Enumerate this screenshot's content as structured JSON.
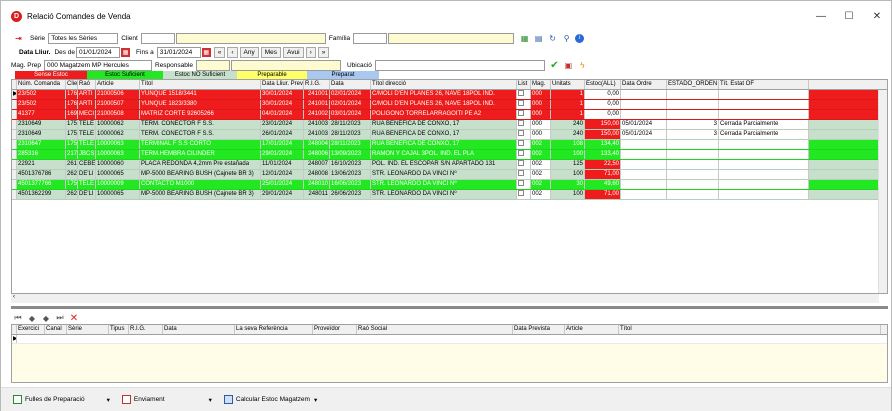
{
  "window": {
    "title": "Relació Comandes de Venda",
    "icon": "D"
  },
  "filters": {
    "serie_label": "Sèrie",
    "serie_value": "Totes les Sèries",
    "client_label": "Client",
    "familia_label": "Família",
    "data_label": "Data Lliur.",
    "des_de": "Des de",
    "des_de_value": "01/01/2024",
    "fins_a": "Fins a",
    "fins_a_value": "31/01/2024",
    "btn_any": "Any",
    "btn_mes": "Mes",
    "btn_avui": "Avui",
    "mag_label": "Mag. Prep",
    "mag_value": "000 Magatzem MP Hercules",
    "responsable_label": "Responsable",
    "ubicacio_label": "Ubicació"
  },
  "legend": [
    "Sense Estoc",
    "Estoc Suficient",
    "Estoc NO Suficient",
    "Preparable",
    "Preparat"
  ],
  "columns": [
    "Núm. Comanda",
    "Client",
    "Raó",
    "Article",
    "Títol",
    "Data Lliur. Prev",
    "R.I.G.",
    "Data",
    "Títol direcció",
    "List",
    "Mag.",
    "Unitats",
    "Estoc(ALL)",
    "Data Ordre",
    "ESTADO_ORDEN",
    "Tít. Estat OF"
  ],
  "rows": [
    {
      "c": [
        "23/502",
        "176",
        "ARTI",
        "21000506",
        "YUNQUE 1518/3441",
        "30/01/2024",
        "241001",
        "02/01/2024",
        "C/MOLI D'EN PLANES 26, NAVE 18POL IND.",
        "",
        "000",
        "1",
        "0,00",
        "",
        "",
        ""
      ],
      "bg": "#ee1c1c",
      "fg": "#fff",
      "estoc_bg": "#fff",
      "estoc_fg": "#000"
    },
    {
      "c": [
        "23/502",
        "176",
        "ARTI",
        "21000507",
        "YUNQUE 1823/3380",
        "30/01/2024",
        "241001",
        "02/01/2024",
        "C/MOLI D'EN PLANES 26, NAVE 18POL IND.",
        "",
        "000",
        "1",
        "0,00",
        "",
        "",
        ""
      ],
      "bg": "#ee1c1c",
      "fg": "#fff",
      "estoc_bg": "#fff",
      "estoc_fg": "#000"
    },
    {
      "c": [
        "41377",
        "169",
        "MECI",
        "21000508",
        "MATRIZ CORTE 92605266",
        "04/01/2024",
        "241002",
        "03/01/2024",
        "POLIGONO TORRELARRAGOITI PE A2",
        "",
        "000",
        "1",
        "0,00",
        "",
        "",
        ""
      ],
      "bg": "#ee1c1c",
      "fg": "#fff",
      "estoc_bg": "#fff",
      "estoc_fg": "#000"
    },
    {
      "c": [
        "2310649",
        "175",
        "TELE",
        "10000062",
        "TERM. CONECTOR F S.S.",
        "23/01/2024",
        "241003",
        "28/11/2023",
        "RUA BENEFICA DE CONXO, 17",
        "",
        "000",
        "240",
        "150,00",
        "05/01/2024",
        "3",
        "Cerrada Parcialmente"
      ],
      "bg": "#c7e0cb",
      "fg": "#000",
      "estoc_bg": "#ee1c1c",
      "estoc_fg": "#fff"
    },
    {
      "c": [
        "2310649",
        "175",
        "TELE",
        "10000062",
        "TERM. CONECTOR F S.S.",
        "26/01/2024",
        "241003",
        "28/11/2023",
        "RUA BENEFICA DE CONXO, 17",
        "",
        "000",
        "240",
        "150,00",
        "05/01/2024",
        "3",
        "Cerrada Parcialmente"
      ],
      "bg": "#c7e0cb",
      "fg": "#000",
      "estoc_bg": "#ee1c1c",
      "estoc_fg": "#fff"
    },
    {
      "c": [
        "2310647",
        "175",
        "TELE",
        "10000063",
        "TERMINAL F S.S CORTO",
        "17/01/2024",
        "248004",
        "28/11/2023",
        "RUA BENEFICA DE CONXO, 17",
        "",
        "002",
        "108",
        "134,40",
        "",
        "",
        ""
      ],
      "bg": "#22e822",
      "fg": "#fff",
      "estoc_bg": "#22e822",
      "estoc_fg": "#fff"
    },
    {
      "c": [
        "285316",
        "217",
        "JBCS",
        "10000063",
        "TERM.HEMBRA CILINDER",
        "29/01/2024",
        "248006",
        "13/09/2023",
        "RAMON Y CAJAL 3POL. IND. EL PLA",
        "",
        "002",
        "100",
        "133,40",
        "",
        "",
        ""
      ],
      "bg": "#22e822",
      "fg": "#fff",
      "estoc_bg": "#22e822",
      "estoc_fg": "#fff"
    },
    {
      "c": [
        "22921",
        "261",
        "CEBE",
        "10000060",
        "PLACA REDONDA 4,2mm Pre estañada",
        "11/01/2024",
        "248007",
        "16/10/2023",
        "POL. IND. EL ESCOPAR S/N APARTADO 131",
        "",
        "002",
        "125",
        "22,50",
        "",
        "",
        ""
      ],
      "bg": "#c7e0cb",
      "fg": "#000",
      "estoc_bg": "#ee1c1c",
      "estoc_fg": "#fff"
    },
    {
      "c": [
        "4501376786",
        "262",
        "DE'LI",
        "10000065",
        "MP-5000 BEARING BUSH (Cajnete BR 3)",
        "12/01/2024",
        "248008",
        "13/06/2023",
        "STR. LEONARDO DA VINCI Nº",
        "",
        "002",
        "100",
        "71,00",
        "",
        "",
        ""
      ],
      "bg": "#c7e0cb",
      "fg": "#000",
      "estoc_bg": "#ee1c1c",
      "estoc_fg": "#fff"
    },
    {
      "c": [
        "4501377766",
        "175",
        "TELE",
        "10000009",
        "CONTACTO M1000",
        "25/01/2024",
        "248010",
        "16/06/2023",
        "STR. LEONARDO DA VINCI Nº",
        "",
        "002",
        "30",
        "49,60",
        "",
        "",
        ""
      ],
      "bg": "#22e822",
      "fg": "#fff",
      "estoc_bg": "#22e822",
      "estoc_fg": "#fff"
    },
    {
      "c": [
        "4501362299",
        "262",
        "DE'LI",
        "10000065",
        "MP-5000 BEARING BUSH (Cajnete BR 3)",
        "29/01/2024",
        "248011",
        "26/06/2023",
        "STR. LEONARDO DA VINCI Nº",
        "",
        "002",
        "100",
        "71,00",
        "",
        "",
        ""
      ],
      "bg": "#c7e0cb",
      "fg": "#000",
      "estoc_bg": "#ee1c1c",
      "estoc_fg": "#fff"
    }
  ],
  "columns2": [
    "Exercici",
    "Canal",
    "Sèrie",
    "Tipus",
    "R.I.G.",
    "Data",
    "La seva Referència",
    "Proveïdor",
    "Raó Social",
    "Data Prevista",
    "Article",
    "Títol"
  ],
  "footer": {
    "btn1": "Fulles de Preparació",
    "btn2": "Enviament",
    "btn3": "Calcular Estoc Magatzem"
  },
  "colors": {
    "red": "#ee1c1c",
    "green": "#22e822",
    "grey_green": "#c7e0cb",
    "yellow": "#ffff66",
    "blue": "#a8c8f0"
  }
}
